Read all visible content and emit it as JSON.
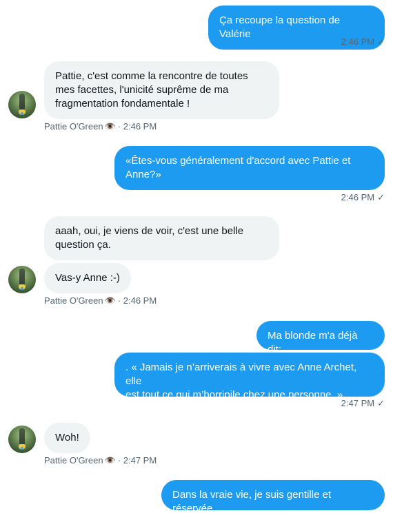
{
  "messages": [
    {
      "dir": "out",
      "text": "Ça recoupe la question de Valérie",
      "time": "2:46 PM",
      "check": "✓"
    },
    {
      "dir": "in",
      "text": "Pattie, c'est comme la rencontre de toutes\nmes facettes, l'unicité suprême de ma\nfragmentation fondamentale !",
      "author": "Pattie O'Green",
      "eye": "👁️",
      "sep": "·",
      "time": "2:46 PM"
    },
    {
      "dir": "out",
      "text": "«Êtes-vous généralement d'accord avec Pattie et\nAnne?»",
      "time": "2:46 PM",
      "check": "✓"
    },
    {
      "dir": "in",
      "text": "aaah, oui, je viens de voir, c'est une belle\nquestion ça.",
      "group": "start"
    },
    {
      "dir": "in",
      "text": "Vas-y Anne :-)",
      "author": "Pattie O'Green",
      "eye": "👁️",
      "sep": "·",
      "time": "2:46 PM"
    },
    {
      "dir": "out",
      "text": "Ma blonde m'a déjà dit:",
      "group": "start"
    },
    {
      "dir": "out",
      "text": ". « Jamais je n’arriverais à vivre avec Anne Archet, elle\nest tout ce qui m’horripile chez une personne. »",
      "time": "2:47 PM",
      "check": "✓"
    },
    {
      "dir": "in",
      "text": "Woh!",
      "author": "Pattie O'Green",
      "eye": "👁️",
      "sep": "·",
      "time": "2:47 PM"
    },
    {
      "dir": "out",
      "text": "Dans la vraie vie, je suis gentille et réservée."
    }
  ],
  "colors": {
    "outgoing": "#1d9bf0",
    "incoming": "#eff3f4",
    "meta": "#536471"
  }
}
